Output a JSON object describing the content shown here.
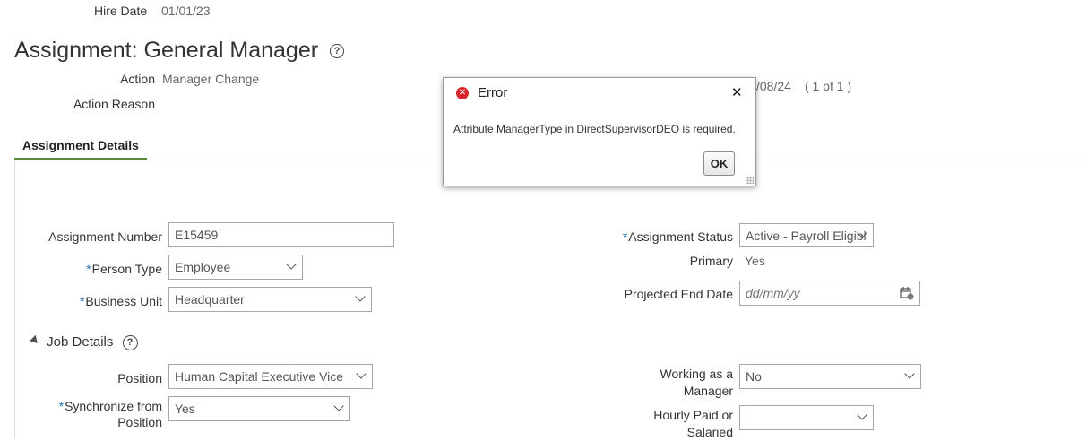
{
  "header": {
    "hire_date_label": "Hire Date",
    "hire_date_value": "01/01/23"
  },
  "page": {
    "title": "Assignment: General Manager",
    "help_icon": "question-circle-icon",
    "action_label": "Action",
    "action_value": "Manager Change",
    "action_reason_label": "Action Reason",
    "effective_date_partial": "/08/24",
    "pager": "( 1 of 1 )"
  },
  "tabs": [
    {
      "label": "Assignment Details"
    }
  ],
  "form": {
    "assignment_number_label": "Assignment Number",
    "assignment_number_value": "E15459",
    "person_type_label": "Person Type",
    "person_type_value": "Employee",
    "business_unit_label": "Business Unit",
    "business_unit_value": "Headquarter",
    "assignment_status_label": "Assignment Status",
    "assignment_status_value": "Active - Payroll Eligible",
    "primary_label": "Primary",
    "primary_value": "Yes",
    "projected_end_date_label": "Projected End Date",
    "projected_end_date_placeholder": "dd/mm/yy",
    "required_marker": "*"
  },
  "job_details": {
    "section_label": "Job Details",
    "position_label": "Position",
    "position_value": "Human Capital Executive Vice",
    "synchronize_label_line1": "Synchronize from",
    "synchronize_label_line2": "Position",
    "synchronize_value": "Yes",
    "working_as_manager_line1": "Working as a",
    "working_as_manager_line2": "Manager",
    "working_as_manager_value": "No",
    "hourly_paid_line1": "Hourly Paid or",
    "hourly_paid_line2": "Salaried",
    "hourly_paid_value": ""
  },
  "dialog": {
    "title": "Error",
    "message": "Attribute ManagerType in DirectSupervisorDEO is required.",
    "ok_label": "OK",
    "close_glyph": "✕",
    "error_icon": "error-x-icon"
  },
  "colors": {
    "accent_green": "#5b8a3c",
    "required_blue": "#1f6fb5",
    "error_red": "#d8262c"
  }
}
